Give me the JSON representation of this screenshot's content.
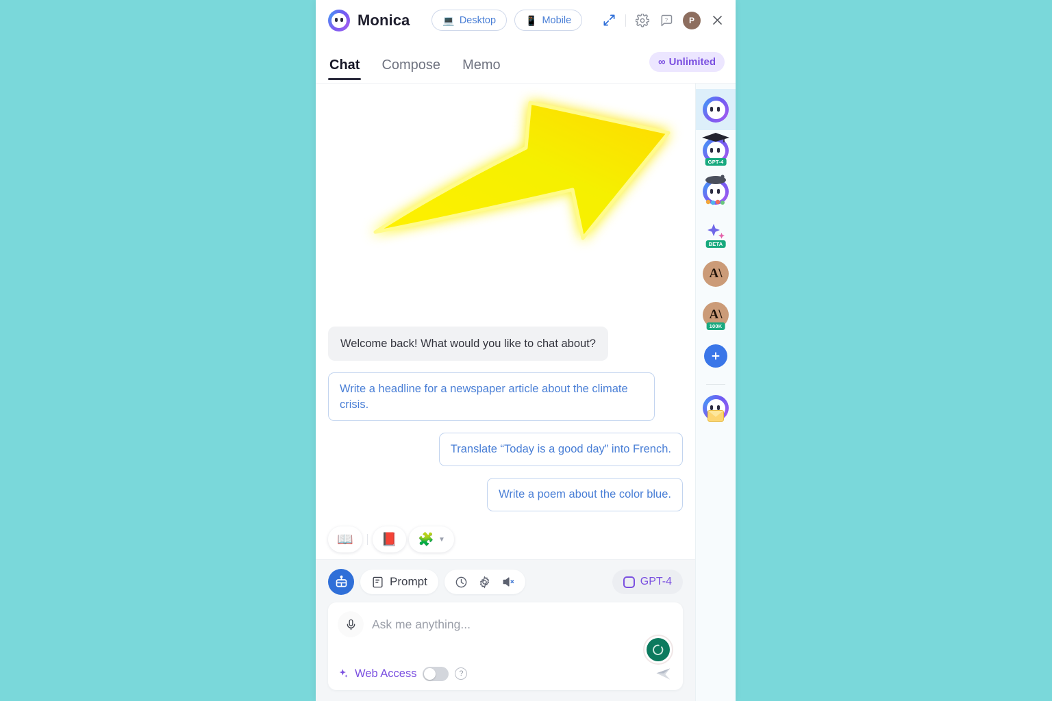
{
  "app": {
    "name": "Monica",
    "background_color": "#7ad8da",
    "panel_background": "#ffffff"
  },
  "header": {
    "logo_icon": "monica-logo-icon",
    "title": "Monica",
    "segments": [
      {
        "label": "Desktop",
        "icon": "desktop-icon",
        "glyph": "💻"
      },
      {
        "label": "Mobile",
        "icon": "mobile-icon",
        "glyph": "📱"
      }
    ],
    "actions": [
      {
        "name": "expand-icon"
      },
      {
        "name": "settings-gear-icon"
      },
      {
        "name": "help-chat-icon"
      }
    ],
    "avatar_initial": "P",
    "close_label": "×"
  },
  "tabs": [
    {
      "label": "Chat",
      "active": true
    },
    {
      "label": "Compose",
      "active": false
    },
    {
      "label": "Memo",
      "active": false
    }
  ],
  "plan_badge": {
    "symbol": "∞",
    "label": "Unlimited",
    "color": "#7a4fe0",
    "background": "#ece6ff"
  },
  "annotation": {
    "type": "hand-drawn-arrow",
    "color": "#fff200",
    "glow_color": "#ffee00",
    "direction": "up-right",
    "description": "Glowing yellow hand-drawn arrow pointing toward upper right"
  },
  "conversation": {
    "bot_message": "Welcome back! What would you like to chat about?",
    "suggestions": [
      {
        "text": "Write a headline for a newspaper article about the climate crisis.",
        "align": "left"
      },
      {
        "text": "Translate “Today is a good day” into French.",
        "align": "right"
      },
      {
        "text": "Write a poem about the color blue.",
        "align": "right"
      }
    ],
    "tool_pills": [
      {
        "name": "book-icon",
        "glyph": "📖"
      },
      {
        "name": "pdf-icon",
        "glyph": "📕"
      },
      {
        "name": "puzzle-extension-icon",
        "glyph": "🧩",
        "caret": "▼"
      }
    ]
  },
  "composer": {
    "bot_button": "bot-avatar-button",
    "prompt_label": "Prompt",
    "mini_icons": [
      {
        "name": "history-clock-icon"
      },
      {
        "name": "settings-gear-icon"
      },
      {
        "name": "mute-speaker-icon"
      }
    ],
    "model_chip": {
      "label": "GPT-4",
      "color": "#7a4fe0"
    },
    "input_placeholder": "Ask me anything...",
    "input_value": "",
    "mic_icon": "microphone-icon",
    "stop_button": "stop-generating-spinner-button",
    "stop_button_color": "#0c7a5e",
    "web_access": {
      "label": "Web Access",
      "enabled": false,
      "help_glyph": "?"
    },
    "send_icon": "send-arrow-icon"
  },
  "rail": {
    "items": [
      {
        "name": "rail-item-monica",
        "type": "monica",
        "active": true,
        "tag": ""
      },
      {
        "name": "rail-item-gpt4-scholar",
        "type": "scholar",
        "active": false,
        "tag": "GPT-4"
      },
      {
        "name": "rail-item-artist",
        "type": "artist",
        "active": false,
        "tag": ""
      },
      {
        "name": "rail-item-gemini",
        "type": "sparkle",
        "active": false,
        "tag": "BETA"
      },
      {
        "name": "rail-item-claude",
        "type": "anthropic",
        "active": false,
        "tag": ""
      },
      {
        "name": "rail-item-claude-100k",
        "type": "anthropic",
        "active": false,
        "tag": "100K"
      },
      {
        "name": "rail-item-add-bot",
        "type": "plus",
        "active": false,
        "tag": ""
      }
    ],
    "footer_item": {
      "name": "rail-item-email",
      "type": "email",
      "tag": ""
    }
  }
}
